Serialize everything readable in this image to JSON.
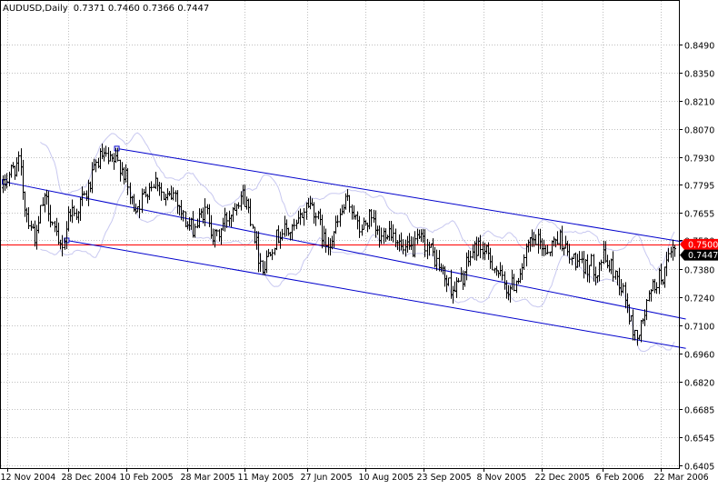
{
  "header": {
    "symbol_timeframe": "AUDUSD,Daily",
    "ohlc": "0.7371 0.7460 0.7366 0.7447"
  },
  "colors": {
    "background": "#ffffff",
    "grid": "#c0c0c0",
    "bars": "#000000",
    "bollinger": "#c8c8f0",
    "channel": "#0000cc",
    "hline": "#ff0000",
    "price_tag_bg": "#000000",
    "hline_tag_bg": "#ff0000",
    "tag_text": "#ffffff"
  },
  "chart_data": {
    "type": "ohlc-bar",
    "title": "AUDUSD,Daily",
    "ylim": [
      0.6405,
      0.863
    ],
    "y_ticks": [
      "0.8490",
      "0.8350",
      "0.8210",
      "0.8070",
      "0.7930",
      "0.7795",
      "0.7655",
      "0.7520",
      "0.7380",
      "0.7240",
      "0.7100",
      "0.6960",
      "0.6820",
      "0.6685",
      "0.6545",
      "0.6405"
    ],
    "x_ticks": [
      "12 Nov 2004",
      "28 Dec 2004",
      "10 Feb 2005",
      "28 Mar 2005",
      "11 May 2005",
      "27 Jun 2005",
      "10 Aug 2005",
      "23 Sep 2005",
      "8 Nov 2005",
      "22 Dec 2005",
      "6 Feb 2006",
      "22 Mar 2006"
    ],
    "last_price": "0.7447",
    "horizontal_line": {
      "value": "0.7500"
    },
    "regression_channel": {
      "mid": {
        "start": [
          "10 Nov 2004",
          0.781
        ],
        "end": [
          "10 Apr 2006",
          0.713
        ]
      },
      "upper": {
        "start": [
          "3 Feb 2005",
          0.7975
        ],
        "end": [
          "10 Apr 2006",
          0.751
        ]
      },
      "lower": {
        "start": [
          "27 Dec 2004",
          0.752
        ],
        "end": [
          "10 Apr 2006",
          0.6985
        ]
      }
    },
    "close_path": [
      0.778,
      0.785,
      0.788,
      0.79,
      0.768,
      0.76,
      0.752,
      0.77,
      0.771,
      0.76,
      0.748,
      0.752,
      0.768,
      0.765,
      0.771,
      0.775,
      0.782,
      0.791,
      0.794,
      0.79,
      0.791,
      0.79,
      0.784,
      0.771,
      0.769,
      0.772,
      0.778,
      0.781,
      0.782,
      0.771,
      0.773,
      0.776,
      0.767,
      0.76,
      0.758,
      0.76,
      0.766,
      0.765,
      0.752,
      0.756,
      0.762,
      0.766,
      0.772,
      0.775,
      0.77,
      0.76,
      0.745,
      0.738,
      0.748,
      0.752,
      0.756,
      0.757,
      0.756,
      0.759,
      0.766,
      0.771,
      0.768,
      0.76,
      0.75,
      0.753,
      0.758,
      0.766,
      0.771,
      0.768,
      0.757,
      0.759,
      0.763,
      0.757,
      0.752,
      0.758,
      0.757,
      0.753,
      0.746,
      0.747,
      0.748,
      0.752,
      0.751,
      0.747,
      0.742,
      0.737,
      0.731,
      0.728,
      0.73,
      0.735,
      0.743,
      0.748,
      0.749,
      0.745,
      0.742,
      0.737,
      0.731,
      0.728,
      0.73,
      0.736,
      0.743,
      0.751,
      0.751,
      0.75,
      0.747,
      0.75,
      0.754,
      0.751,
      0.742,
      0.743,
      0.738,
      0.739,
      0.74,
      0.737,
      0.744,
      0.74,
      0.737,
      0.732,
      0.724,
      0.712,
      0.704,
      0.709,
      0.72,
      0.728,
      0.733,
      0.735,
      0.742,
      0.747
    ]
  }
}
